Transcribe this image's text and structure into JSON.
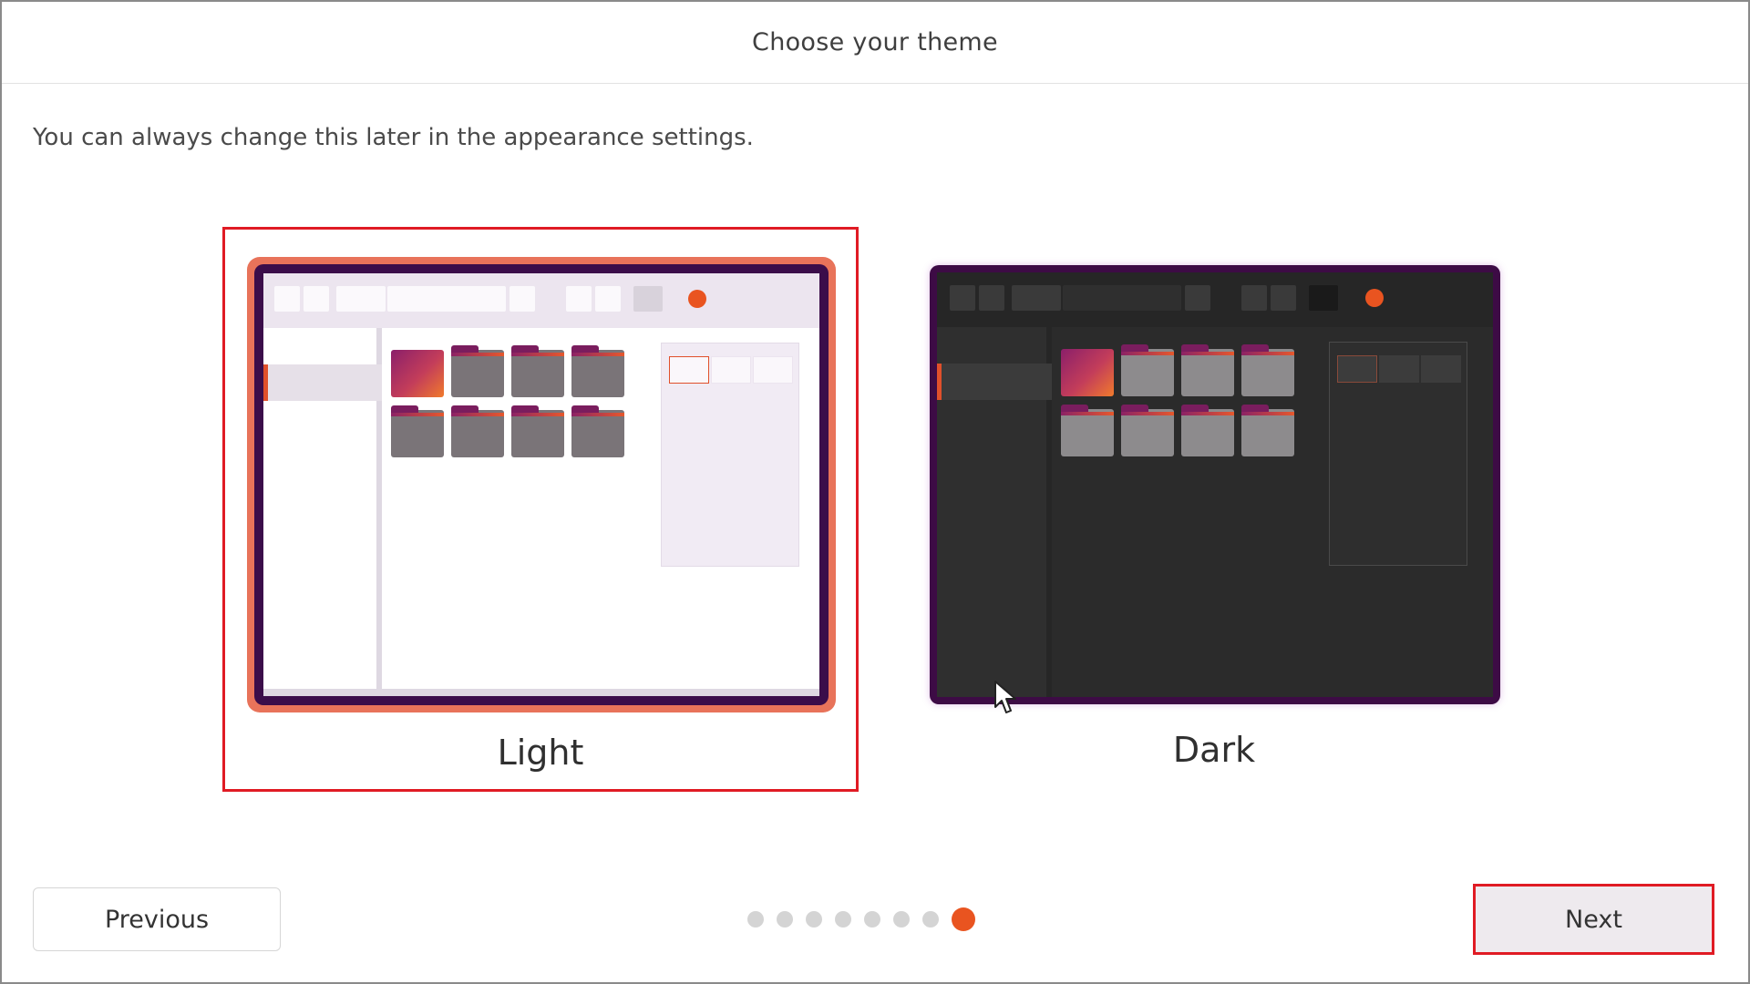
{
  "header": {
    "title": "Choose your theme"
  },
  "subtitle": "You can always change this later in the appearance settings.",
  "themes": [
    {
      "label": "Light",
      "selected": true
    },
    {
      "label": "Dark",
      "selected": false
    }
  ],
  "footer": {
    "previous_label": "Previous",
    "next_label": "Next",
    "pager": {
      "total": 8,
      "current": 8
    }
  },
  "colors": {
    "accent": "#e95420",
    "selection_outline": "#e01b24",
    "light_frame": "#3b0d4a",
    "dark_frame": "#3d0b45"
  },
  "icons": {
    "cursor": "mouse-pointer-icon"
  }
}
